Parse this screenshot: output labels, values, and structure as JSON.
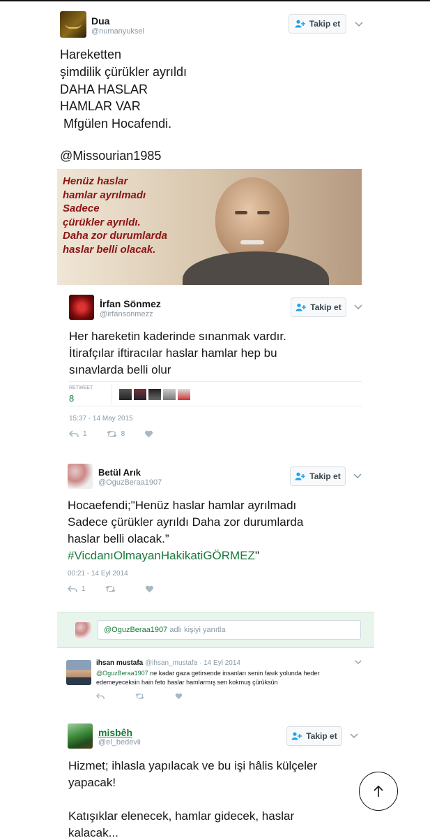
{
  "follow_label": "Takip et",
  "tweet1": {
    "name": "Dua",
    "handle": "@numanyuksel",
    "lines": [
      "Hareketten",
      "şimdilik çürükler ayrıldı",
      "DAHA HASLAR",
      "HAMLAR VAR",
      " Mfgülen Hocafendi."
    ],
    "mention": "@Missourian1985",
    "image_lines": [
      "Henüz haslar",
      "hamlar ayrılmadı",
      "Sadece",
      "çürükler ayrıldı.",
      "Daha zor durumlarda",
      "haslar belli olacak."
    ]
  },
  "tweet2": {
    "name": "İrfan Sönmez",
    "handle": "@irfansonmezz",
    "lines": [
      "Her hareketin kaderinde sınanmak vardır.",
      "İtirafçılar iftiracılar haslar hamlar hep bu",
      "sınavlarda belli olur"
    ],
    "retweet_label": "RETWEET",
    "retweet_count": "8",
    "timestamp": "15:37 - 14 May 2015",
    "reply_count": "1",
    "rt_count": "8"
  },
  "tweet3": {
    "name": "Betül Arık",
    "handle": "@OguzBeraa1907",
    "lines": [
      "Hocaefendi;\"Henüz haslar hamlar ayrılmadı",
      "Sadece çürükler ayrıldı Daha zor durumlarda",
      "haslar belli olacak.”"
    ],
    "hashtag": "#VicdanıOlmayanHakikatiGÖRMEZ",
    "hashtag_after": "\"",
    "timestamp": "00:21 - 14 Eyl 2014",
    "reply_count": "1"
  },
  "reply_box": {
    "mention": "@OguzBeraa1907",
    "suffix": " adlı kişiyi yanıtla"
  },
  "reply": {
    "name": "ihsan mustafa",
    "handle": "@ihsan_mustafa",
    "date": "· 14 Eyl 2014",
    "mention": "@OguzBeraa1907",
    "text1": " ne kadar gaza getirsende insanları senin fasık yolunda heder",
    "text2": "edemeyeceksin hain feto haslar hamlarmış sen kokmuş çürüksün"
  },
  "tweet4": {
    "name": "misbêh",
    "handle": "@el_bedevii",
    "lines": [
      "Hizmet; ihlasla yapılacak ve bu işi hâlis külçeler",
      "yapacak!",
      "",
      "Katışıklar elenecek, hamlar gidecek, haslar",
      "kalacak..."
    ]
  },
  "colors": {
    "accent": "#1b7a3e",
    "muted": "#8899a6",
    "reply_bar": "#e8f5ec"
  },
  "icons": [
    "person-plus-icon",
    "chevron-down-icon",
    "reply-icon",
    "retweet-icon",
    "heart-icon",
    "arrow-up-icon"
  ]
}
